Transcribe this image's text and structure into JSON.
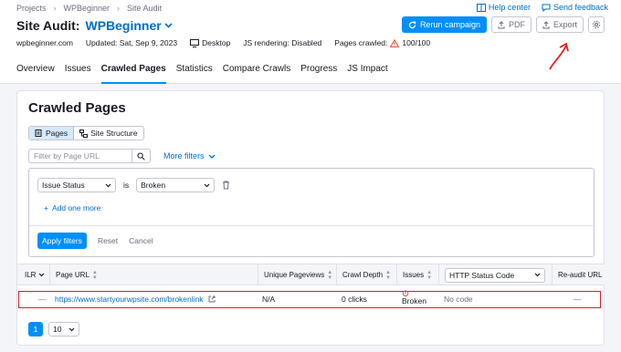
{
  "breadcrumbs": [
    "Projects",
    "WPBeginner",
    "Site Audit"
  ],
  "top_links": {
    "help": "Help center",
    "feedback": "Send feedback"
  },
  "header": {
    "title_prefix": "Site Audit:",
    "project": "WPBeginner",
    "rerun": "Rerun campaign",
    "pdf": "PDF",
    "export": "Export"
  },
  "meta": {
    "domain": "wpbeginner.com",
    "updated": "Updated: Sat, Sep 9, 2023",
    "device": "Desktop",
    "js": "JS rendering: Disabled",
    "crawled_label": "Pages crawled:",
    "crawled_value": "100/100"
  },
  "tabs": [
    "Overview",
    "Issues",
    "Crawled Pages",
    "Statistics",
    "Compare Crawls",
    "Progress",
    "JS Impact"
  ],
  "active_tab": 2,
  "card": {
    "title": "Crawled Pages",
    "view_pages": "Pages",
    "view_structure": "Site Structure",
    "search_placeholder": "Filter by Page URL",
    "more_filters": "More filters"
  },
  "filter": {
    "field": "Issue Status",
    "operator": "is",
    "value": "Broken",
    "add_more": "Add one more",
    "apply": "Apply filters",
    "reset": "Reset",
    "cancel": "Cancel"
  },
  "table": {
    "columns": {
      "ilr": "ILR",
      "url": "Page URL",
      "uniq": "Unique Pageviews",
      "depth": "Crawl Depth",
      "issues": "Issues",
      "status_select": "HTTP Status Code",
      "reaudit": "Re-audit URL"
    },
    "row": {
      "ilr": "—",
      "url": "https://www.startyourwpsite.com/brokenlink",
      "uniq": "N/A",
      "depth": "0 clicks",
      "issue": "Broken",
      "status": "No code",
      "reaudit": "—"
    }
  },
  "pagination": {
    "page": "1",
    "per_page": "10"
  },
  "colors": {
    "accent": "#008ff8",
    "link": "#006dca",
    "highlight": "#d0202e"
  }
}
